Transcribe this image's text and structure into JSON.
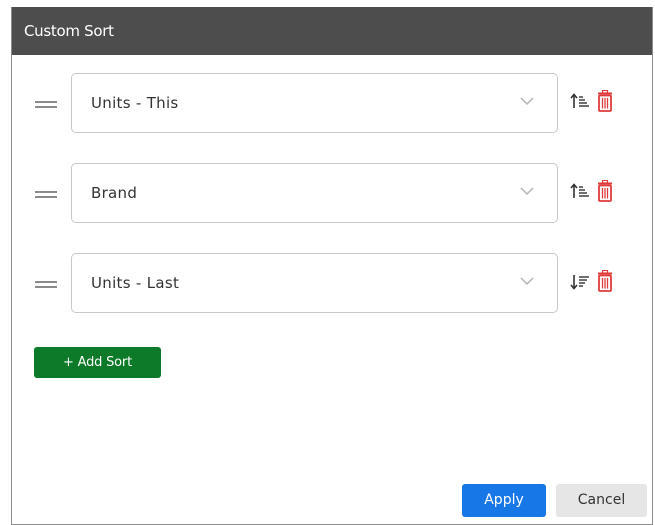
{
  "dialog": {
    "title": "Custom Sort"
  },
  "sorts": [
    {
      "field": "Units - This",
      "direction_icon": "sort-ascending-icon"
    },
    {
      "field": "Brand",
      "direction_icon": "sort-ascending-icon"
    },
    {
      "field": "Units - Last",
      "direction_icon": "sort-descending-icon"
    }
  ],
  "actions": {
    "add_sort_label": "+ Add Sort",
    "apply_label": "Apply",
    "cancel_label": "Cancel"
  },
  "colors": {
    "titlebar": "#4d4d4d",
    "add_sort": "#0c7a28",
    "apply": "#1877e6",
    "delete_icon": "#e03b3b"
  }
}
